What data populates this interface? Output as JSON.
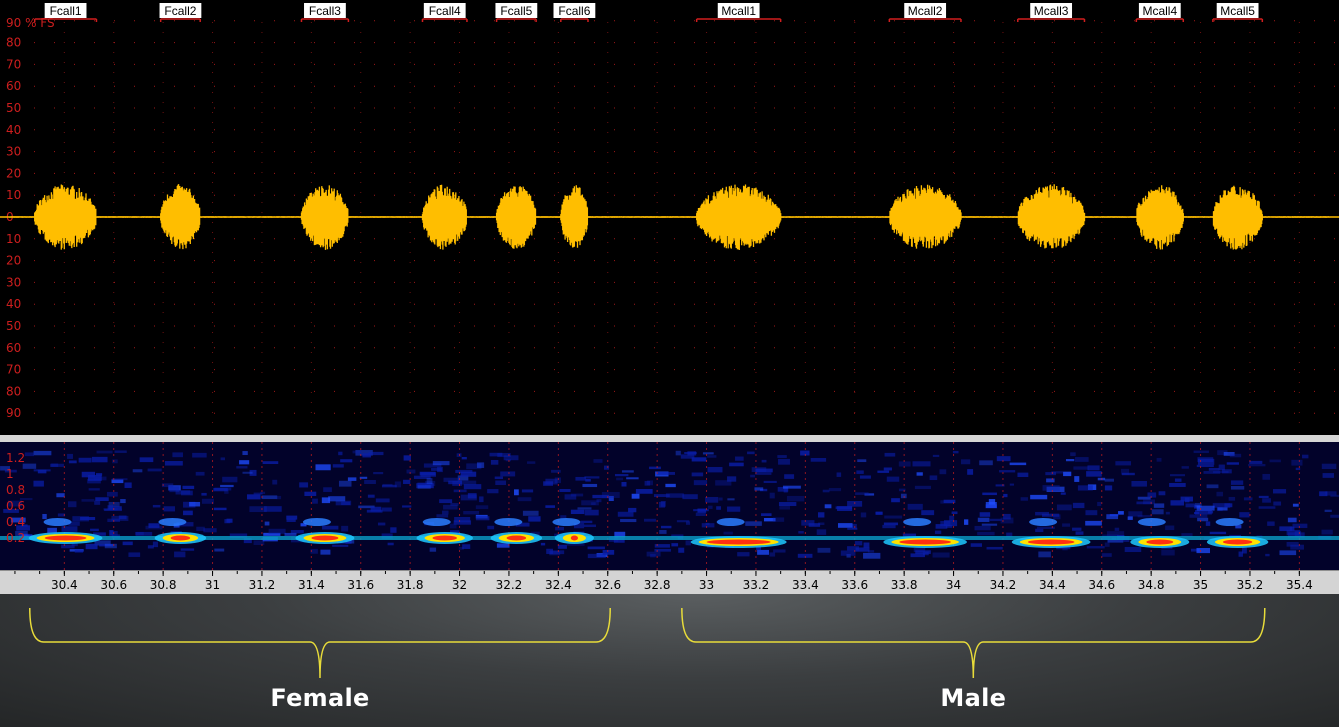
{
  "waveform": {
    "unit_label": "90 % FS",
    "amplitude_labels": [
      "80",
      "70",
      "60",
      "50",
      "40",
      "30",
      "20",
      "10",
      "0",
      "10",
      "20",
      "30",
      "40",
      "50",
      "60",
      "70",
      "80",
      "90"
    ],
    "color": "#ffbe00",
    "grid_color": "#c81e1e"
  },
  "calls": [
    {
      "label": "Fcall1",
      "start": 30.28,
      "end": 30.53
    },
    {
      "label": "Fcall2",
      "start": 30.79,
      "end": 30.95
    },
    {
      "label": "Fcall3",
      "start": 31.36,
      "end": 31.55
    },
    {
      "label": "Fcall4",
      "start": 31.85,
      "end": 32.03
    },
    {
      "label": "Fcall5",
      "start": 32.15,
      "end": 32.31
    },
    {
      "label": "Fcall6",
      "start": 32.41,
      "end": 32.52
    },
    {
      "label": "Mcall1",
      "start": 32.96,
      "end": 33.3
    },
    {
      "label": "Mcall2",
      "start": 33.74,
      "end": 34.03
    },
    {
      "label": "Mcall3",
      "start": 34.26,
      "end": 34.53
    },
    {
      "label": "Mcall4",
      "start": 34.74,
      "end": 34.93
    },
    {
      "label": "Mcall5",
      "start": 35.05,
      "end": 35.25
    }
  ],
  "spectrogram": {
    "frequency_labels": [
      "1.2",
      "1",
      "0.8",
      "0.6",
      "0.4",
      "0.2"
    ]
  },
  "time_axis": {
    "ticks": [
      "30.4",
      "30.6",
      "30.8",
      "31",
      "31.2",
      "31.4",
      "31.6",
      "31.8",
      "32",
      "32.2",
      "32.4",
      "32.6",
      "32.8",
      "33",
      "33.2",
      "33.4",
      "33.6",
      "33.8",
      "34",
      "34.2",
      "34.4",
      "34.6",
      "34.8",
      "35",
      "35.2",
      "35.4"
    ],
    "range": [
      30.18,
      35.52
    ]
  },
  "groups": [
    {
      "label": "Female",
      "start": 30.26,
      "end": 32.61
    },
    {
      "label": "Male",
      "start": 32.9,
      "end": 35.26
    }
  ],
  "colors": {
    "bracket": "#e8dc3a",
    "label_text": "#ffffff",
    "call_marker": "#d21e1e"
  }
}
